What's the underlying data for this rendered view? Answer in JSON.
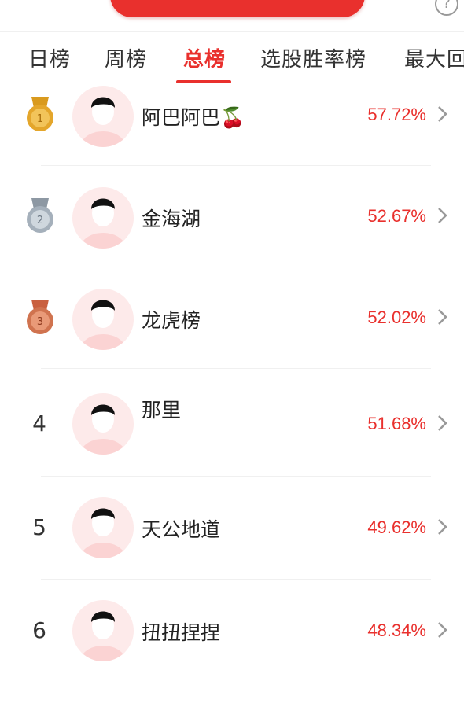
{
  "tabs": [
    {
      "label": "日榜",
      "active": false
    },
    {
      "label": "周榜",
      "active": false
    },
    {
      "label": "总榜",
      "active": true
    },
    {
      "label": "选股胜率榜",
      "active": false
    },
    {
      "label": "最大回",
      "active": false
    }
  ],
  "help_icon": "help-icon",
  "colors": {
    "accent": "#e9302d",
    "gold": "#d99a1e",
    "silver": "#9aa6b2",
    "bronze": "#c9603f"
  },
  "rankings": [
    {
      "rank": "1",
      "medal": "gold",
      "name": "阿巴阿巴🍒",
      "rate": "57.72%"
    },
    {
      "rank": "2",
      "medal": "silver",
      "name": "金海湖",
      "rate": "52.67%"
    },
    {
      "rank": "3",
      "medal": "bronze",
      "name": "龙虎榜",
      "rate": "52.02%"
    },
    {
      "rank": "4",
      "medal": null,
      "name": "那里",
      "rate": "51.68%"
    },
    {
      "rank": "5",
      "medal": null,
      "name": "天公地道",
      "rate": "49.62%"
    },
    {
      "rank": "6",
      "medal": null,
      "name": "扭扭捏捏",
      "rate": "48.34%"
    }
  ]
}
